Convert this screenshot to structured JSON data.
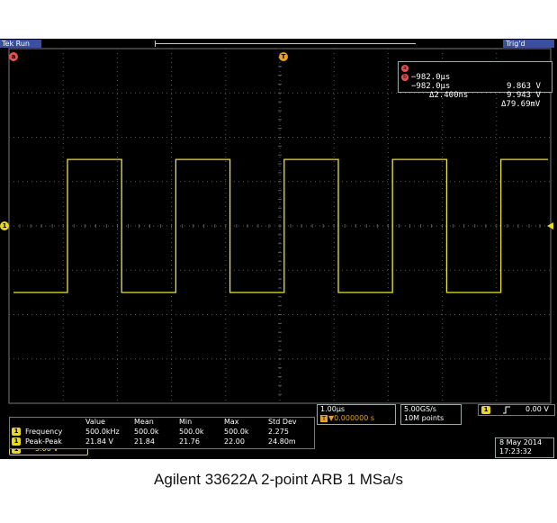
{
  "status": {
    "brand": "Tek",
    "run": "Run",
    "trig": "Trig'd"
  },
  "channel": {
    "number": "1",
    "scale": "5.00 V"
  },
  "cursors": {
    "a": {
      "label": "a",
      "time": "−982.0µs",
      "volt": "9.863 V"
    },
    "b": {
      "label": "b",
      "time": "−982.0µs",
      "volt": "9.943 V"
    },
    "delta_time": "Δ2.400ns",
    "delta_volt": "Δ79.69mV"
  },
  "measurements": {
    "headers": [
      "Value",
      "Mean",
      "Min",
      "Max",
      "Std Dev"
    ],
    "rows": [
      {
        "ch": "1",
        "name": "Frequency",
        "value": "500.0kHz",
        "mean": "500.0k",
        "min": "500.0k",
        "max": "500.0k",
        "std": "2.275"
      },
      {
        "ch": "1",
        "name": "Peak-Peak",
        "value": "21.84 V",
        "mean": "21.84",
        "min": "21.76",
        "max": "22.00",
        "std": "24.80m"
      }
    ]
  },
  "timebase": {
    "scale": "1.00µs",
    "delay": "▼0.000000 s"
  },
  "acquisition": {
    "rate": "5.00GS/s",
    "points": "10M points"
  },
  "trigger": {
    "channel": "1",
    "slope_icon": "rising-edge",
    "level": "0.00 V"
  },
  "datetime": {
    "date": "8 May 2014",
    "time": "17:23:32"
  },
  "caption": "Agilent 33622A 2-point ARB 1 MSa/s",
  "colors": {
    "trace": "#e8e040",
    "channel": "#e8d820",
    "grid": "#5a5a5a",
    "status_bar": "#3a4fa0",
    "cursor_marker": "#e85050"
  }
}
